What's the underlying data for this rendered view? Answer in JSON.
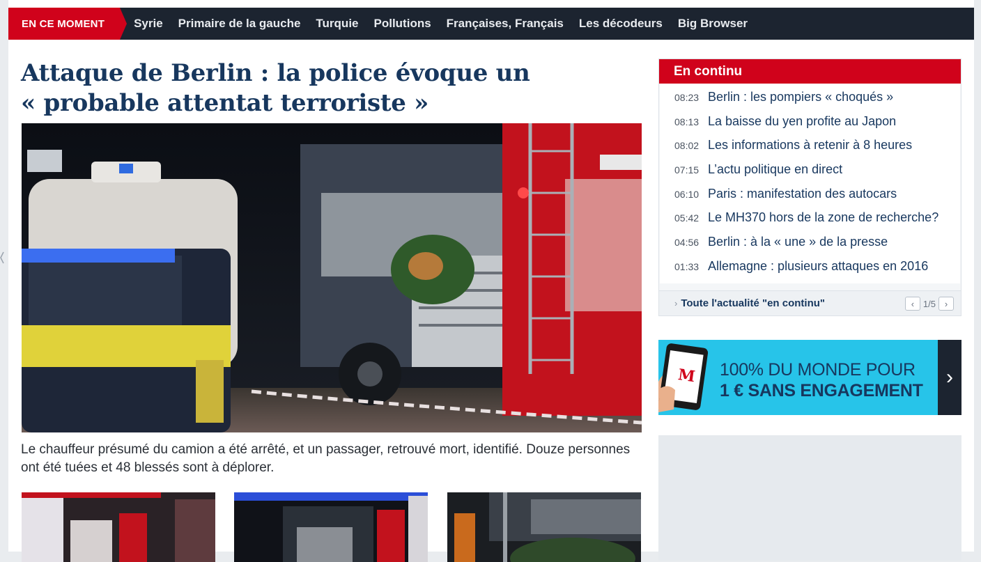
{
  "colors": {
    "accent_red": "#d0021b",
    "nav_dark": "#1c2430",
    "headline_navy": "#17375e",
    "ad_cyan": "#27c4e9"
  },
  "topnav": {
    "badge": "EN CE MOMENT",
    "links": [
      "Syrie",
      "Primaire de la gauche",
      "Turquie",
      "Pollutions",
      "Françaises, Français",
      "Les décodeurs",
      "Big Browser"
    ]
  },
  "article": {
    "headline_line1": "Attaque de Berlin : la police évoque un",
    "headline_line2": "« probable attentat terroriste »",
    "caption": "Le chauffeur présumé du camion a été arrêté, et un passager, retrouvé mort, identifié. Douze personnes ont été tuées et 48 blessés sont à déplorer."
  },
  "live": {
    "title": "En continu",
    "items": [
      {
        "time": "08:23",
        "title": "Berlin : les pompiers « choqués »"
      },
      {
        "time": "08:13",
        "title": "La baisse du yen profite au Japon"
      },
      {
        "time": "08:02",
        "title": "Les informations à retenir à 8 heures"
      },
      {
        "time": "07:15",
        "title": "L’actu politique en direct"
      },
      {
        "time": "06:10",
        "title": "Paris : manifestation des autocars"
      },
      {
        "time": "05:42",
        "title": "Le MH370 hors de la zone de recherche?"
      },
      {
        "time": "04:56",
        "title": "Berlin : à la « une » de la presse"
      },
      {
        "time": "01:33",
        "title": "Allemagne : plusieurs attaques en 2016"
      }
    ],
    "footer_link": "Toute l'actualité \"en continu\"",
    "pager": "1/5"
  },
  "ad": {
    "line1": "100% DU MONDE POUR",
    "line2": "1 € SANS ENGAGEMENT",
    "arrow": "›",
    "phone_logo": "M"
  }
}
